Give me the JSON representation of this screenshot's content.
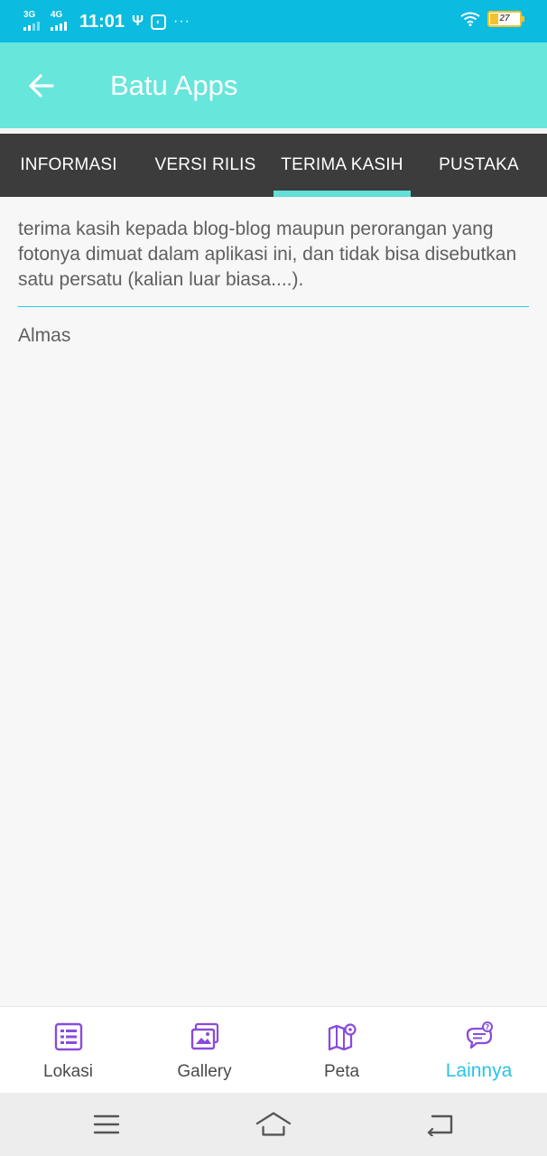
{
  "status_bar": {
    "network_1": "3G",
    "network_2": "4G",
    "time": "11:01",
    "usb_icon": "usb-icon",
    "notif_icon": "usb-debug-icon",
    "more": "···",
    "battery_level": "27",
    "battery_fraction": 0.27
  },
  "app_bar": {
    "title": "Batu Apps",
    "back_icon": "arrow-left-icon"
  },
  "tabs": {
    "items": [
      {
        "label": "INFORMASI"
      },
      {
        "label": "VERSI RILIS"
      },
      {
        "label": "TERIMA KASIH"
      },
      {
        "label": "PUSTAKA"
      }
    ],
    "active_index": 2
  },
  "content": {
    "thanks_text": "terima kasih kepada blog-blog maupun perorangan yang fotonya dimuat dalam aplikasi ini, dan tidak bisa disebutkan satu persatu (kalian luar biasa....).",
    "names": [
      "Almas"
    ]
  },
  "bottom_nav": {
    "items": [
      {
        "label": "Lokasi",
        "icon": "list-icon"
      },
      {
        "label": "Gallery",
        "icon": "gallery-icon"
      },
      {
        "label": "Peta",
        "icon": "map-icon"
      },
      {
        "label": "Lainnya",
        "icon": "chat-help-icon"
      }
    ],
    "active_index": 3
  },
  "colors": {
    "status_bar": "#0bbbe0",
    "app_bar": "#67e6dc",
    "tab_bar": "#3c3c3c",
    "tab_indicator": "#62dfd7",
    "accent": "#27c4e4",
    "icon_purple": "#8a4bdc"
  }
}
